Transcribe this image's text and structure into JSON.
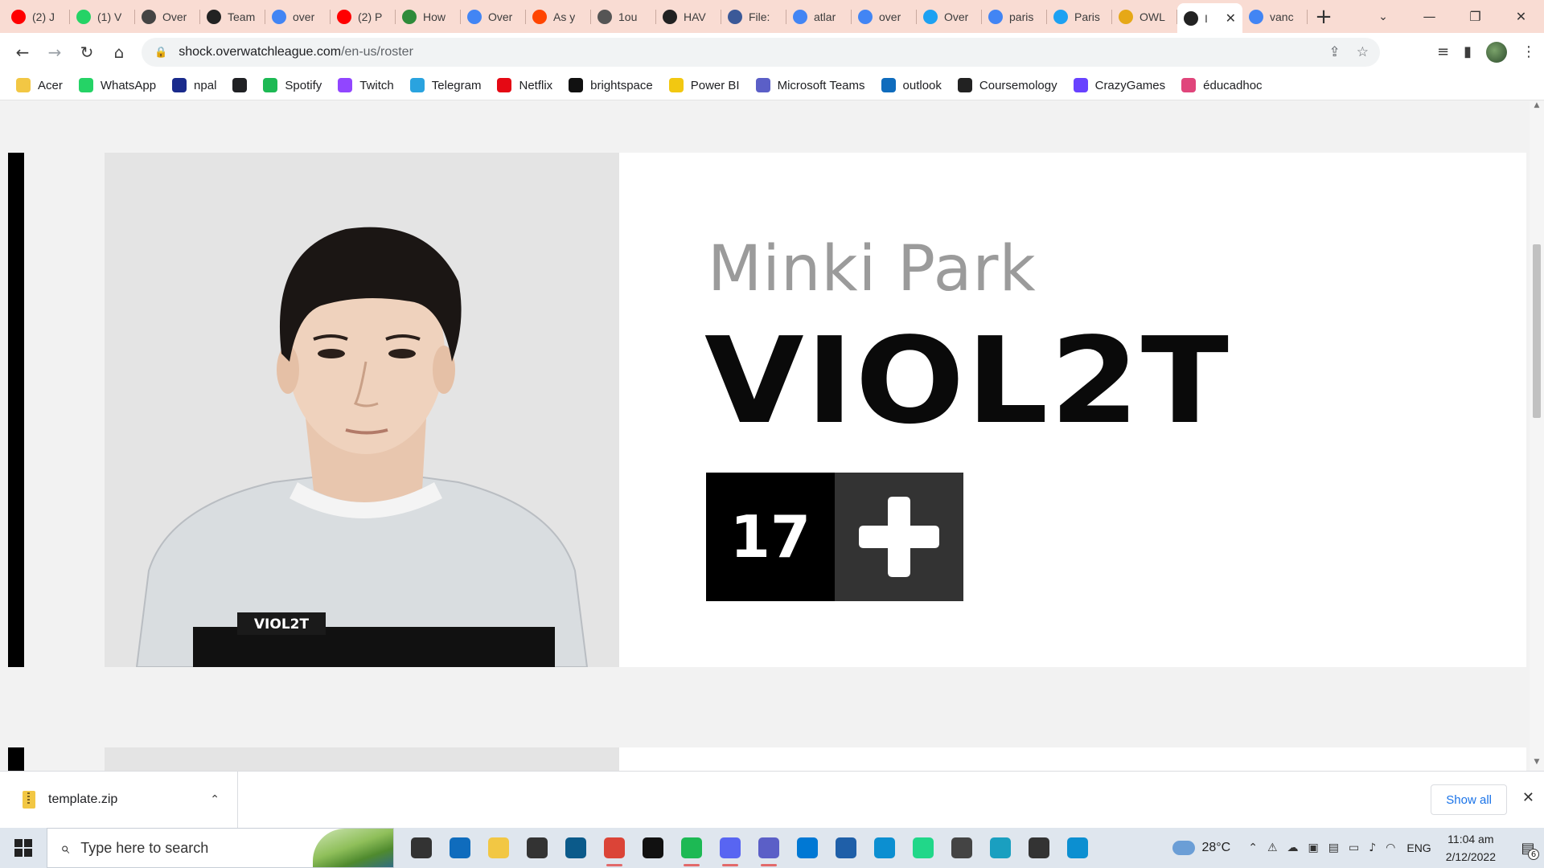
{
  "browser": {
    "tabs": [
      {
        "title": "(2) J",
        "icon": "youtube-icon",
        "color": "#ff0000"
      },
      {
        "title": "(1) V",
        "icon": "whatsapp-icon",
        "color": "#25d366"
      },
      {
        "title": "Over",
        "icon": "overwatch-icon",
        "color": "#444444"
      },
      {
        "title": "Team",
        "icon": "shock-icon",
        "color": "#222222"
      },
      {
        "title": "over",
        "icon": "google-icon",
        "color": "#4285f4"
      },
      {
        "title": "(2) P",
        "icon": "youtube-icon",
        "color": "#ff0000"
      },
      {
        "title": "How",
        "icon": "wikihow-icon",
        "color": "#2e8b3a"
      },
      {
        "title": "Over",
        "icon": "google-icon",
        "color": "#4285f4"
      },
      {
        "title": "As y",
        "icon": "reddit-icon",
        "color": "#ff4500"
      },
      {
        "title": "1ou",
        "icon": "globe-icon",
        "color": "#555555"
      },
      {
        "title": "HAV",
        "icon": "shock-icon",
        "color": "#222222"
      },
      {
        "title": "File:",
        "icon": "wiki-icon",
        "color": "#3b5998"
      },
      {
        "title": "atlar",
        "icon": "google-icon",
        "color": "#4285f4"
      },
      {
        "title": "over",
        "icon": "google-icon",
        "color": "#4285f4"
      },
      {
        "title": "Over",
        "icon": "twitter-icon",
        "color": "#1da1f2"
      },
      {
        "title": "paris",
        "icon": "google-icon",
        "color": "#4285f4"
      },
      {
        "title": "Paris",
        "icon": "twitter-icon",
        "color": "#1da1f2"
      },
      {
        "title": "OWL",
        "icon": "owl-icon",
        "color": "#e6a817"
      },
      {
        "title": "I",
        "icon": "shock-icon",
        "color": "#222222",
        "active": true
      },
      {
        "title": "vanc",
        "icon": "google-icon",
        "color": "#4285f4"
      }
    ],
    "url": "shock.overwatchleague.com",
    "url_path": "/en-us/roster",
    "bookmarks": [
      {
        "label": "Acer",
        "icon": "folder-icon",
        "color": "#f2c744"
      },
      {
        "label": "WhatsApp",
        "icon": "whatsapp-icon",
        "color": "#25d366"
      },
      {
        "label": "npal",
        "icon": "npal-icon",
        "color": "#1a2b8c"
      },
      {
        "label": "",
        "icon": "globe-icon",
        "color": "#202124"
      },
      {
        "label": "Spotify",
        "icon": "spotify-icon",
        "color": "#1db954"
      },
      {
        "label": "Twitch",
        "icon": "twitch-icon",
        "color": "#9146ff"
      },
      {
        "label": "Telegram",
        "icon": "telegram-icon",
        "color": "#2aa3df"
      },
      {
        "label": "Netflix",
        "icon": "netflix-icon",
        "color": "#e50914"
      },
      {
        "label": "brightspace",
        "icon": "np-icon",
        "color": "#111111"
      },
      {
        "label": "Power BI",
        "icon": "powerbi-icon",
        "color": "#f2c811"
      },
      {
        "label": "Microsoft Teams",
        "icon": "teams-icon",
        "color": "#5b5fc7"
      },
      {
        "label": "outlook",
        "icon": "outlook-icon",
        "color": "#0f6cbd"
      },
      {
        "label": "Coursemology",
        "icon": "coursemology-icon",
        "color": "#222222"
      },
      {
        "label": "CrazyGames",
        "icon": "crazygames-icon",
        "color": "#6842ff"
      },
      {
        "label": "éducadhoc",
        "icon": "educadhoc-icon",
        "color": "#e0457b"
      }
    ]
  },
  "player": {
    "real_name": "Minki Park",
    "handle": "VIOL2T",
    "number": "17",
    "role_icon": "support-plus-icon",
    "jersey_text": "VIOL2T"
  },
  "downloads": {
    "file_name": "template.zip",
    "show_all": "Show all"
  },
  "taskbar": {
    "search_placeholder": "Type here to search",
    "weather": "28°C",
    "language": "ENG",
    "time": "11:04 am",
    "date": "2/12/2022",
    "notification_count": "6",
    "apps": [
      {
        "icon": "task-view-icon",
        "color": "#333333"
      },
      {
        "icon": "mail-icon",
        "color": "#0f6cbd"
      },
      {
        "icon": "file-explorer-icon",
        "color": "#f2c744"
      },
      {
        "icon": "dropbox-icon",
        "color": "#333333"
      },
      {
        "icon": "store-icon",
        "color": "#0b5a8a"
      },
      {
        "icon": "chrome-icon",
        "color": "#db4437",
        "open": true
      },
      {
        "icon": "netflix-icon",
        "color": "#111111"
      },
      {
        "icon": "spotify-icon",
        "color": "#1db954",
        "open": true
      },
      {
        "icon": "discord-icon",
        "color": "#5865f2",
        "open": true
      },
      {
        "icon": "teams-icon",
        "color": "#5b5fc7",
        "open": true
      },
      {
        "icon": "vscode-icon",
        "color": "#0078d4"
      },
      {
        "icon": "photos-icon",
        "color": "#1f5fa8"
      },
      {
        "icon": "edge-icon",
        "color": "#0c8fd1"
      },
      {
        "icon": "pycharm-icon",
        "color": "#21d789"
      },
      {
        "icon": "unity-icon",
        "color": "#444444"
      },
      {
        "icon": "maya-icon",
        "color": "#1a9fc0"
      },
      {
        "icon": "unity-hub-icon",
        "color": "#333333"
      },
      {
        "icon": "edge-dev-icon",
        "color": "#0c8fd1"
      }
    ]
  }
}
